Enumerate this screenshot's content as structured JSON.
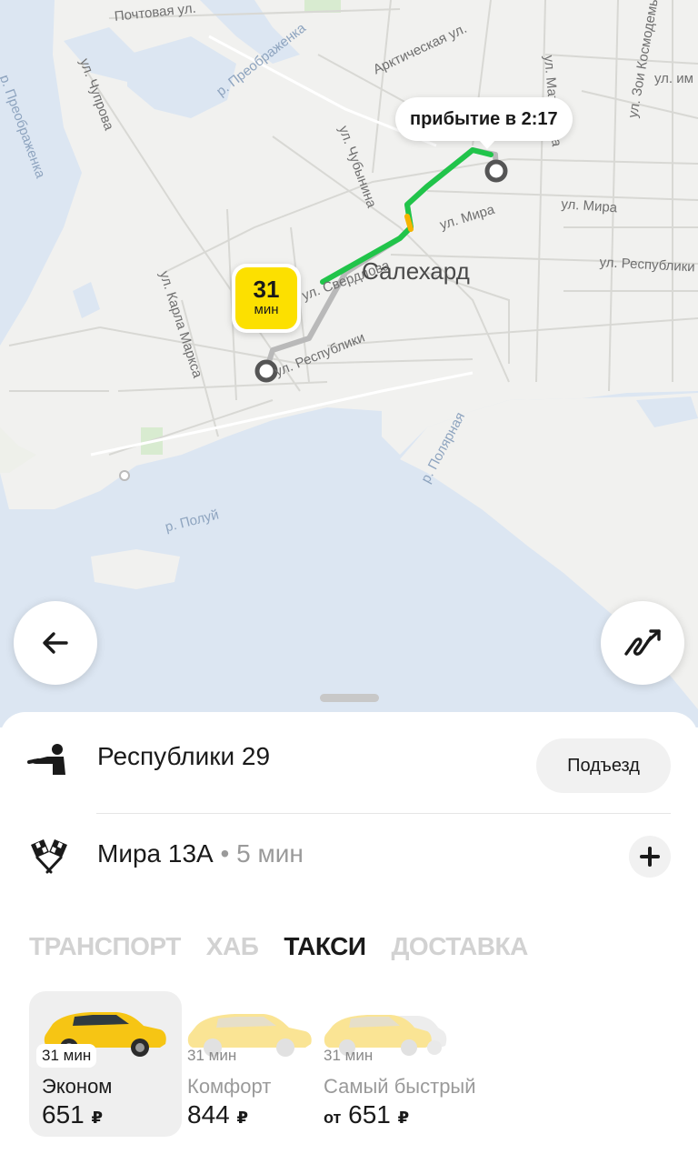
{
  "colors": {
    "accent_yellow": "#fce000",
    "route_green": "#21c44a",
    "water": "#dce6f2",
    "land": "#f1f1ef"
  },
  "map": {
    "city": "Салехард",
    "eta_badge": {
      "value": "31",
      "unit": "мин"
    },
    "arrival_tooltip": "прибытие в 2:17",
    "street_labels": [
      "Почтовая ул.",
      "р. Преображенка",
      "Арктическая ул.",
      "ул. Матросова",
      "ул. Зои Космодемьянской",
      "ул. им",
      "ул. Чупрова",
      "р. Преображенка",
      "ул. Чубынина",
      "ул. Мира",
      "ул. Мира",
      "ул. Республики",
      "ул. Карла Маркса",
      "ул. Свердлова",
      "ул. Республики",
      "р. Полярная",
      "р. Полуй"
    ],
    "buttons": {
      "back_icon": "arrow-left-icon",
      "route_icon": "route-icon"
    }
  },
  "route": {
    "from": {
      "address": "Республики 29",
      "icon": "person-pointing-icon",
      "action_label": "Подъезд"
    },
    "to": {
      "address": "Мира 13А",
      "meta": "5 мин",
      "icon": "checkered-flags-icon",
      "action_icon": "plus-icon"
    }
  },
  "tabs": [
    {
      "label": "ТРАНСПОРТ",
      "active": false
    },
    {
      "label": "ХАБ",
      "active": false
    },
    {
      "label": "ТАКСИ",
      "active": true
    },
    {
      "label": "ДОСТАВКА",
      "active": false
    }
  ],
  "tariffs": [
    {
      "name": "Эконом",
      "time": "31 мин",
      "price_prefix": "",
      "price": "651",
      "currency": "₽",
      "selected": true
    },
    {
      "name": "Комфорт",
      "time": "31 мин",
      "price_prefix": "",
      "price": "844",
      "currency": "₽",
      "selected": false
    },
    {
      "name": "Самый быстрый",
      "time": "31 мин",
      "price_prefix": "от",
      "price": "651",
      "currency": "₽",
      "selected": false
    }
  ]
}
